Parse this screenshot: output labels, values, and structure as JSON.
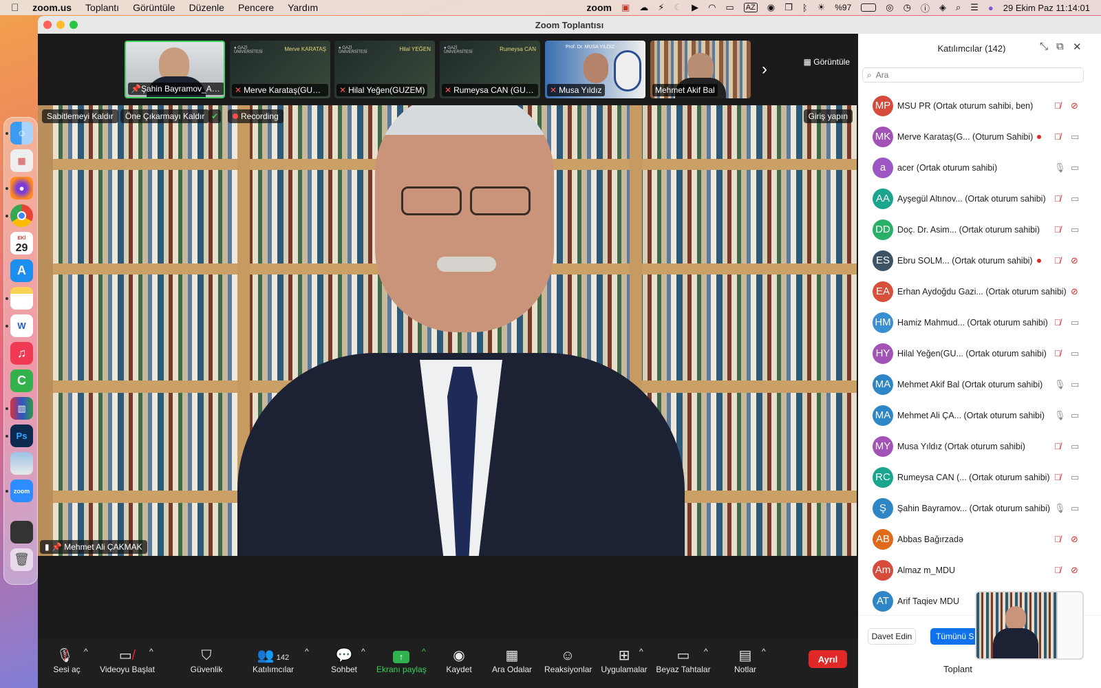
{
  "menubar": {
    "app": "zoom.us",
    "items": [
      "Toplantı",
      "Görüntüle",
      "Düzenle",
      "Pencere",
      "Yardım"
    ],
    "status_zoom": "zoom",
    "keyboard": "AZ",
    "battery": "%97",
    "datetime": "29 Ekim Paz  11:14:01"
  },
  "dock": {
    "calendar_month": "EKİ",
    "calendar_day": "29",
    "word": "W",
    "photoshop": "Ps",
    "zoom": "zoom"
  },
  "window": {
    "title": "Zoom Toplantısı"
  },
  "strip": {
    "gallery_view": "Görüntüle",
    "thumbs": [
      {
        "name": "Şahin Bayramov_Aze...",
        "muted": false,
        "pinned": true,
        "banner": ""
      },
      {
        "name": "Merve Karataş(GUZE...",
        "muted": true,
        "pinned": false,
        "banner": "Merve KARATAŞ"
      },
      {
        "name": "Hilal Yeğen(GUZEM)",
        "muted": true,
        "pinned": false,
        "banner": "Hilal YEĞEN"
      },
      {
        "name": "Rumeysa CAN (GUZE...",
        "muted": true,
        "pinned": false,
        "banner": "Rumeysa CAN"
      },
      {
        "name": "Musa Yıldız",
        "muted": true,
        "pinned": false,
        "banner": "Prof. Dr. MUSA YILDIZ"
      },
      {
        "name": "Mehmet Akif Bal",
        "muted": false,
        "pinned": false,
        "banner": ""
      }
    ]
  },
  "video": {
    "unpin": "Sabitlemeyi Kaldır",
    "unspotlight": "Öne Çıkarmayı Kaldır",
    "recording": "Recording",
    "signin": "Giriş yapın",
    "speaker": "Mehmet Ali ÇAKMAK"
  },
  "toolbar": {
    "audio": "Sesi aç",
    "video": "Videoyu Başlat",
    "security": "Güvenlik",
    "participants": "Katılımcılar",
    "participants_count": "142",
    "chat": "Sohbet",
    "share": "Ekranı paylaş",
    "record": "Kaydet",
    "breakout": "Ara Odalar",
    "reactions": "Reaksiyonlar",
    "apps": "Uygulamalar",
    "whiteboards": "Beyaz Tahtalar",
    "notes": "Notlar",
    "leave": "Ayrıl"
  },
  "panel": {
    "title": "Katılımcılar (142)",
    "search_placeholder": "Ara",
    "invite": "Davet Edin",
    "mute_all": "Tümünü S",
    "footer_text": "Toplant",
    "participants": [
      {
        "initials": "MP",
        "color": "#d64b3c",
        "name": "MSU PR (Ortak oturum sahibi, ben)",
        "rec": false,
        "mic": "muted",
        "cam": "off"
      },
      {
        "initials": "MK",
        "color": "#a352b5",
        "name": "Merve Karataş(G... (Oturum Sahibi)",
        "rec": true,
        "mic": "muted",
        "cam": "on"
      },
      {
        "initials": "a",
        "color": "#9d57c4",
        "name": "acer (Ortak oturum sahibi)",
        "rec": false,
        "mic": "on",
        "cam": "on"
      },
      {
        "initials": "AA",
        "color": "#1aa58f",
        "name": "Ayşegül Altınov...   (Ortak oturum sahibi)",
        "rec": false,
        "mic": "muted",
        "cam": "on"
      },
      {
        "initials": "DD",
        "color": "#29b067",
        "name": "Doç. Dr. Asim...     (Ortak oturum sahibi)",
        "rec": false,
        "mic": "muted",
        "cam": "on"
      },
      {
        "initials": "ES",
        "color": "#3d5366",
        "name": "Ebru SOLM... (Ortak oturum sahibi)",
        "rec": true,
        "mic": "muted",
        "cam": "off"
      },
      {
        "initials": "EA",
        "color": "#d6503a",
        "name": "Erhan Aydoğdu Gazi...  (Ortak oturum sahibi)",
        "rec": false,
        "mic": "none",
        "cam": "off"
      },
      {
        "initials": "HM",
        "color": "#3a8fd0",
        "name": "Hamiz Mahmud...   (Ortak oturum sahibi)",
        "rec": false,
        "mic": "muted",
        "cam": "on"
      },
      {
        "initials": "HY",
        "color": "#a352b5",
        "name": "Hilal Yeğen(GU...   (Ortak oturum sahibi)",
        "rec": false,
        "mic": "muted",
        "cam": "on"
      },
      {
        "initials": "MA",
        "color": "#2f86c7",
        "name": "Mehmet Akif Bal (Ortak oturum sahibi)",
        "rec": false,
        "mic": "on",
        "cam": "on"
      },
      {
        "initials": "MA",
        "color": "#2f86c7",
        "name": "Mehmet Ali ÇA...    (Ortak oturum sahibi)",
        "rec": false,
        "mic": "on",
        "cam": "on"
      },
      {
        "initials": "MY",
        "color": "#a352b5",
        "name": "Musa Yıldız (Ortak oturum sahibi)",
        "rec": false,
        "mic": "muted",
        "cam": "on"
      },
      {
        "initials": "RC",
        "color": "#1aa58f",
        "name": "Rumeysa CAN (...   (Ortak oturum sahibi)",
        "rec": false,
        "mic": "muted",
        "cam": "on"
      },
      {
        "initials": "Ş",
        "color": "#2f86c7",
        "name": "Şahin Bayramov...   (Ortak oturum sahibi)",
        "rec": false,
        "mic": "on",
        "cam": "on"
      },
      {
        "initials": "AB",
        "color": "#e06a1b",
        "name": "Abbas Bağırzadə",
        "rec": false,
        "mic": "muted",
        "cam": "off"
      },
      {
        "initials": "Am",
        "color": "#d64b3c",
        "name": "Almaz m_MDU",
        "rec": false,
        "mic": "muted",
        "cam": "off"
      },
      {
        "initials": "AT",
        "color": "#2f86c7",
        "name": "Arif Taqiev MDU",
        "rec": false,
        "mic": "none",
        "cam": "none"
      }
    ]
  }
}
